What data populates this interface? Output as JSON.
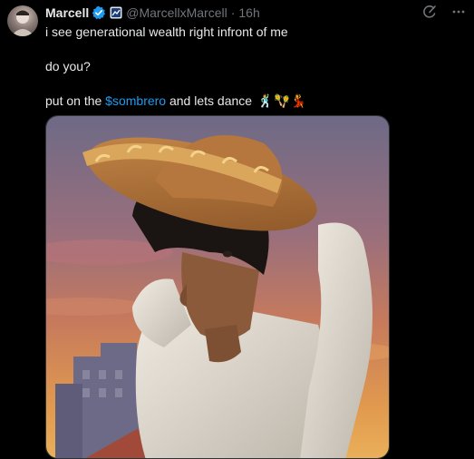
{
  "tweet": {
    "author_name": "Marcell",
    "handle": "@MarcellxMarcell",
    "separator": "·",
    "time": "16h",
    "lines": [
      "i see generational wealth right infront of me",
      "do you?"
    ],
    "last_line_prefix": "put on the ",
    "cashtag": "$sombrero",
    "last_line_suffix": " and lets dance ",
    "emojis": "🕺🪇💃"
  },
  "icons": {
    "verified": "verified-badge-icon",
    "affiliate": "affiliate-badge-icon",
    "grok": "grok-icon",
    "more": "more-options-icon"
  },
  "colors": {
    "background": "#000000",
    "text": "#e7e9ea",
    "muted": "#71767b",
    "link": "#1d9bf0",
    "verified": "#1d9bf0"
  }
}
